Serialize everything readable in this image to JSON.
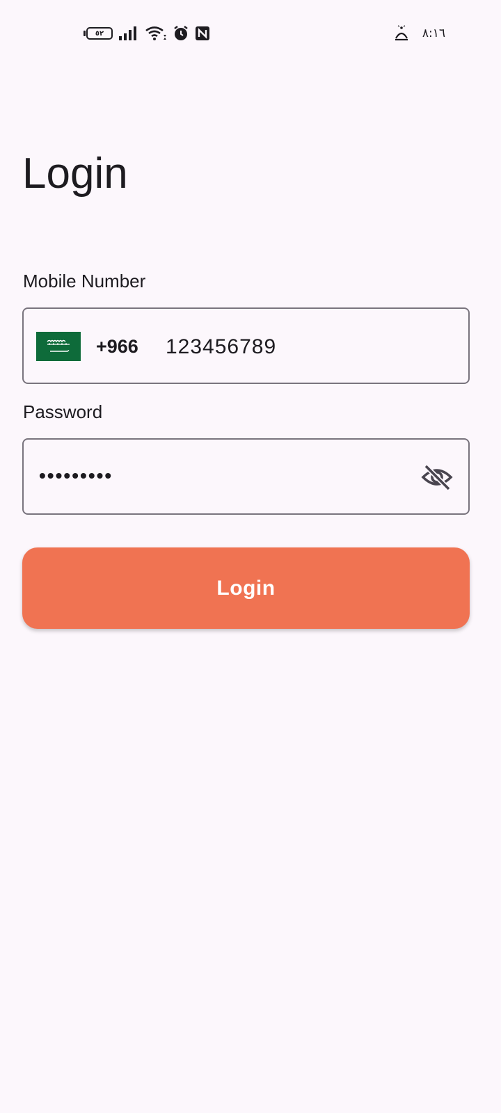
{
  "status_bar": {
    "battery_level": "٥٢",
    "time": "٨:١٦",
    "icons": [
      "battery-icon",
      "signal-icon",
      "wifi-icon",
      "alarm-icon",
      "nfc-icon",
      "prayer-bell-icon"
    ]
  },
  "page": {
    "title": "Login"
  },
  "mobile": {
    "label": "Mobile Number",
    "country_flag": "saudi-arabia-flag",
    "country_code": "+966",
    "value": "123456789"
  },
  "password": {
    "label": "Password",
    "masked_value": "•••••••••",
    "visibility_icon": "eye-off-icon"
  },
  "login_button": {
    "label": "Login"
  },
  "colors": {
    "background": "#fcf7fc",
    "accent": "#f07352",
    "flag_green": "#0e6b3a",
    "outline": "#79747e"
  }
}
